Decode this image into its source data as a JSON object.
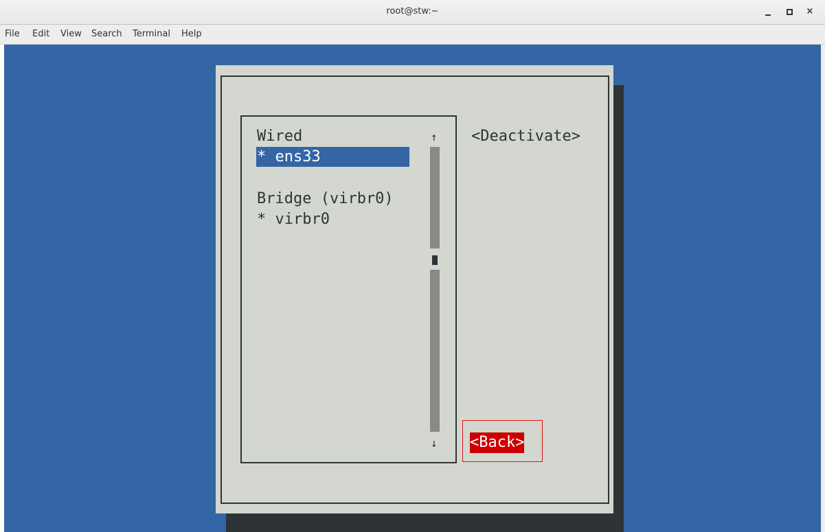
{
  "window": {
    "title": "root@stw:~",
    "controls": {
      "minimize": "_",
      "maximize": "□",
      "close": "×"
    }
  },
  "menubar": {
    "items": [
      "File",
      "Edit",
      "View",
      "Search",
      "Terminal",
      "Help"
    ]
  },
  "nmtui": {
    "connections": [
      {
        "group": "Wired",
        "device": "* ens33",
        "selected": true
      },
      {
        "group": "Bridge (virbr0)",
        "device": "* virbr0",
        "selected": false
      }
    ],
    "scroll_up": "↑",
    "scroll_down": "↓",
    "deactivate_button": "<Deactivate>",
    "back_button": "<Back>"
  },
  "colors": {
    "terminal_background": "#3465a4",
    "dialog_background": "#d3d7cf",
    "dialog_shadow": "#2e3436",
    "selection": "#3465a4",
    "back_button": "#cc0000",
    "highlight_box": "#e01010"
  }
}
